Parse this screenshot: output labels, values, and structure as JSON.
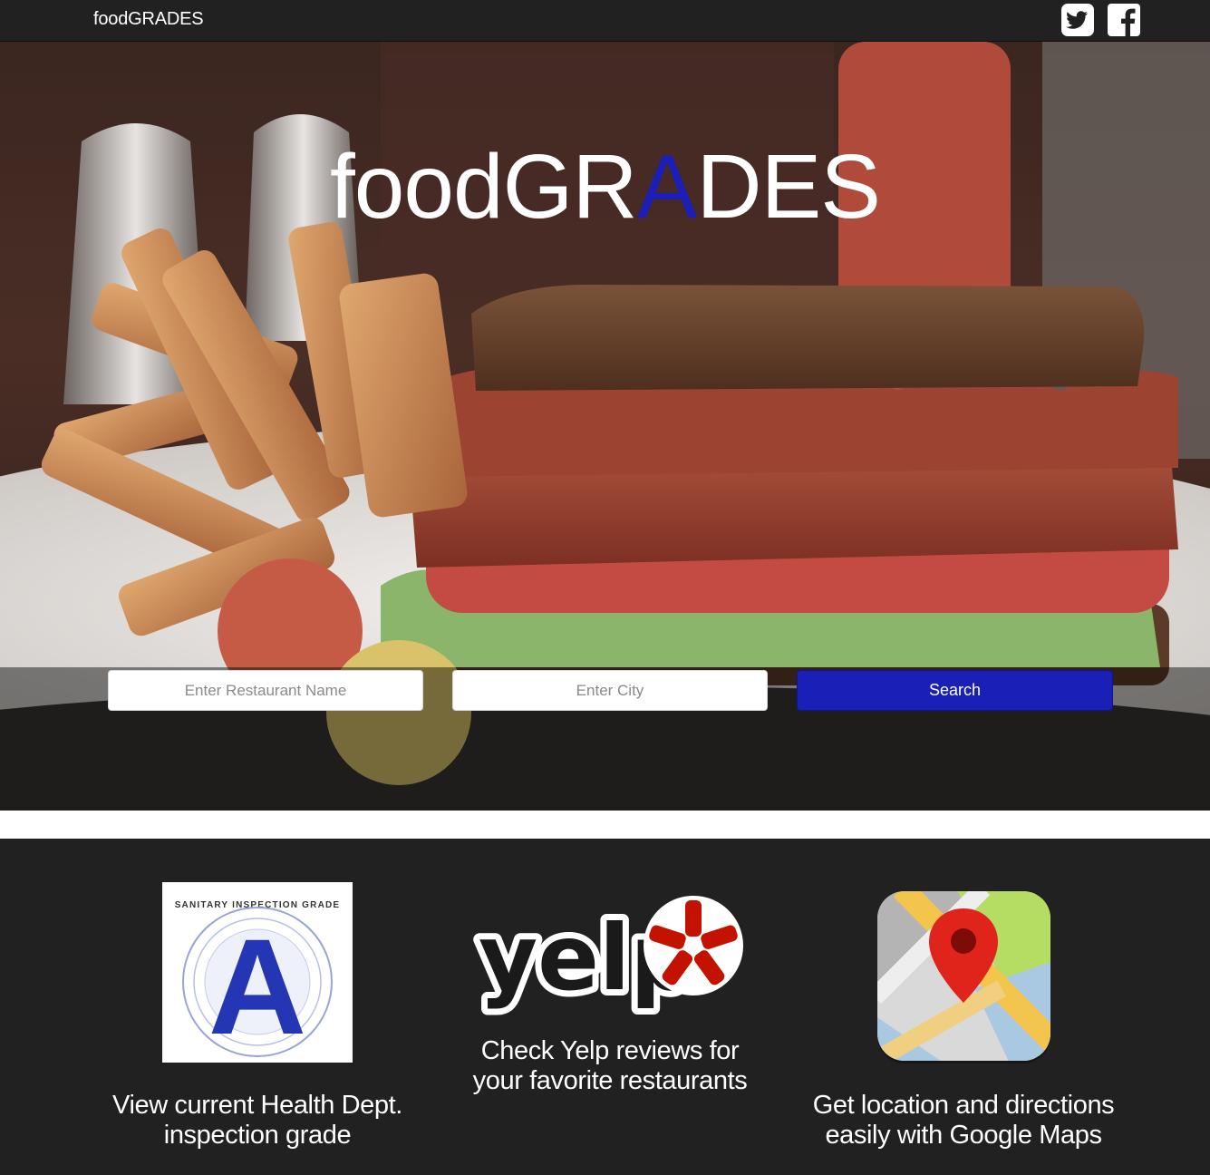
{
  "navbar": {
    "brand": "foodGRADES",
    "social": [
      {
        "icon": "twitter-icon"
      },
      {
        "icon": "facebook-icon"
      }
    ]
  },
  "hero": {
    "title_prefix": "foodGR",
    "title_accent": "A",
    "title_suffix": "DES",
    "accent_color": "#1c1fb5"
  },
  "search": {
    "restaurant_placeholder": "Enter Restaurant Name",
    "restaurant_value": "",
    "city_placeholder": "Enter City",
    "city_value": "",
    "button_label": "Search",
    "button_color": "#1a1fb8"
  },
  "features": [
    {
      "icon": "inspection-grade-icon",
      "badge_heading": "SANITARY INSPECTION GRADE",
      "badge_letter": "A",
      "caption_line1": "View current Health Dept.",
      "caption_line2": "inspection grade"
    },
    {
      "icon": "yelp-logo",
      "logo_text": "yelp",
      "caption_line1": "Check Yelp reviews for",
      "caption_line2": "your favorite restaurants"
    },
    {
      "icon": "google-maps-icon",
      "caption_line1": "Get location and directions",
      "caption_line2": "easily with Google Maps"
    }
  ]
}
